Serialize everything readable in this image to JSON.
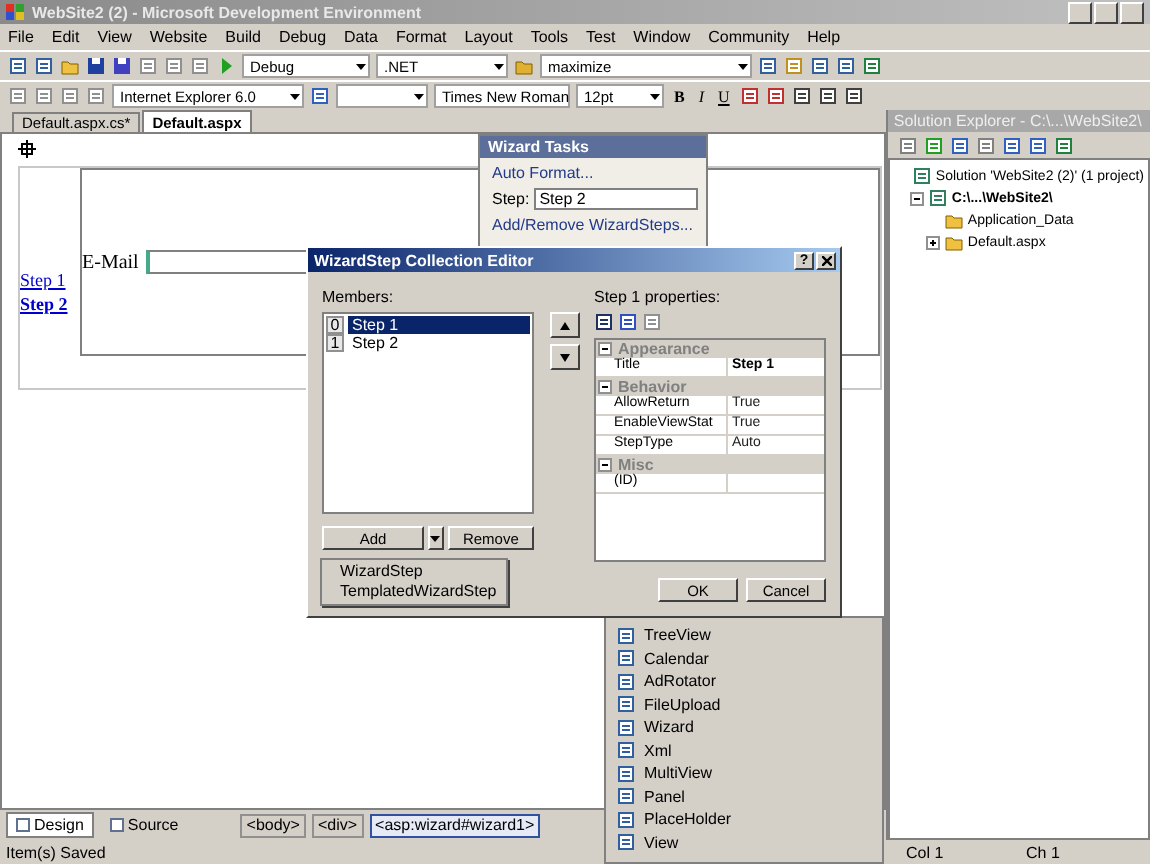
{
  "window": {
    "title": "WebSite2 (2) - Microsoft Development Environment"
  },
  "menu": [
    "File",
    "Edit",
    "View",
    "Website",
    "Build",
    "Debug",
    "Data",
    "Format",
    "Layout",
    "Tools",
    "Test",
    "Window",
    "Community",
    "Help"
  ],
  "toolbar": {
    "configuration": "Debug",
    "platform": ".NET",
    "find": "maximize",
    "target_schema": "Internet Explorer 6.0",
    "font": "Times New Roman",
    "size": "12pt",
    "format_buttons": [
      "B",
      "I",
      "U"
    ]
  },
  "document_tabs": [
    {
      "label": "Default.aspx.cs*",
      "selected": false
    },
    {
      "label": "Default.aspx",
      "selected": true
    }
  ],
  "designer": {
    "sidebar_links": [
      "Step 1",
      "Step 2"
    ],
    "field_label": "E-Mail"
  },
  "wizard_tasks": {
    "title": "Wizard Tasks",
    "auto_format": "Auto Format...",
    "step_label": "Step:",
    "step_value": "Step 2",
    "add_remove": "Add/Remove WizardSteps..."
  },
  "dialog": {
    "title": "WizardStep Collection Editor",
    "help_button": "?",
    "members_label": "Members:",
    "members": [
      {
        "index": "0",
        "name": "Step 1",
        "selected": true
      },
      {
        "index": "1",
        "name": "Step 2",
        "selected": false
      }
    ],
    "properties_label": "Step 1 properties:",
    "categories": [
      {
        "name": "Appearance",
        "expanded": true,
        "properties": [
          {
            "name": "Title",
            "value": "Step 1",
            "modified": true
          }
        ]
      },
      {
        "name": "Behavior",
        "expanded": true,
        "properties": [
          {
            "name": "AllowReturn",
            "value": "True",
            "modified": false
          },
          {
            "name": "EnableViewStat",
            "value": "True",
            "modified": false
          },
          {
            "name": "StepType",
            "value": "Auto",
            "modified": false
          }
        ]
      },
      {
        "name": "Misc",
        "expanded": true,
        "properties": [
          {
            "name": "(ID)",
            "modified": false
          }
        ]
      }
    ],
    "add": "Add",
    "remove": "Remove",
    "ok": "OK",
    "cancel": "Cancel",
    "add_menu": [
      "WizardStep",
      "TemplatedWizardStep"
    ]
  },
  "toolbox": {
    "items": [
      "TreeView",
      "Calendar",
      "AdRotator",
      "FileUpload",
      "Wizard",
      "Xml",
      "MultiView",
      "Panel",
      "PlaceHolder",
      "View"
    ]
  },
  "solution_explorer": {
    "title": "Solution Explorer - C:\\...\\WebSite2\\",
    "tree": [
      {
        "label": "Solution 'WebSite2 (2)' (1 project)",
        "children": [
          {
            "label": "C:\\...\\WebSite2\\",
            "expanded": true,
            "children": [
              {
                "label": "Application_Data"
              },
              {
                "label": "Default.aspx",
                "expanded": false
              }
            ]
          }
        ]
      }
    ]
  },
  "view_tabs": [
    {
      "label": "Design",
      "selected": true
    },
    {
      "label": "Source",
      "selected": false
    }
  ],
  "breadcrumb": [
    {
      "label": "<body>",
      "selected": false
    },
    {
      "label": "<div>",
      "selected": false
    },
    {
      "label": "<asp:wizard#wizard1>",
      "selected": true
    }
  ],
  "status_bar": {
    "message": "Item(s) Saved",
    "column": "Col 1",
    "char": "Ch 1"
  }
}
